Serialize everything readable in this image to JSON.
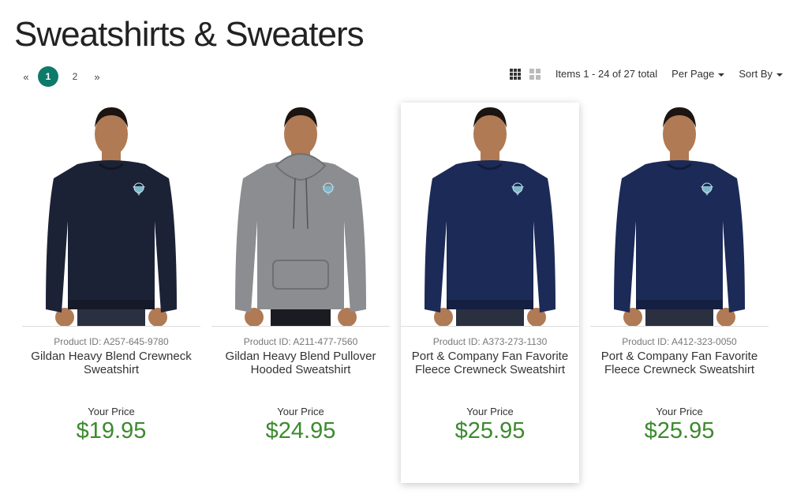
{
  "title": "Sweatshirts & Sweaters",
  "pagination": {
    "prev": "«",
    "pages": [
      "1",
      "2"
    ],
    "next": "»",
    "current": "1"
  },
  "toolbar": {
    "items_text": "Items 1 - 24 of 27 total",
    "per_page": "Per Page",
    "sort_by": "Sort By"
  },
  "products": [
    {
      "id": "Product ID: A257-645-9780",
      "name": "Gildan Heavy Blend Crewneck Sweatshirt",
      "price_label": "Your Price",
      "price": "$19.95",
      "garment_color": "#1c2236",
      "style": "crew"
    },
    {
      "id": "Product ID: A211-477-7560",
      "name": "Gildan Heavy Blend Pullover Hooded Sweatshirt",
      "price_label": "Your Price",
      "price": "$24.95",
      "garment_color": "#8c8d90",
      "style": "hood"
    },
    {
      "id": "Product ID: A373-273-1130",
      "name": "Port & Company Fan Favorite Fleece Crewneck Sweatshirt",
      "price_label": "Your Price",
      "price": "$25.95",
      "garment_color": "#1c2a57",
      "style": "crew"
    },
    {
      "id": "Product ID: A412-323-0050",
      "name": "Port & Company Fan Favorite Fleece Crewneck Sweatshirt",
      "price_label": "Your Price",
      "price": "$25.95",
      "garment_color": "#1c2a57",
      "style": "crew"
    }
  ],
  "colors": {
    "accent": "#0e7a6a",
    "price": "#3c8a2e"
  }
}
